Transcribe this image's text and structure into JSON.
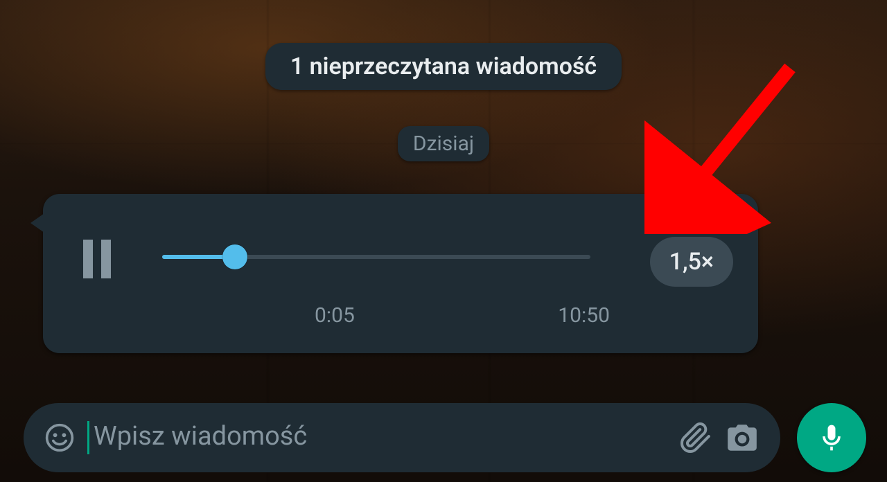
{
  "unread_banner": "1 nieprzeczytana wiadomość",
  "date_label": "Dzisiaj",
  "voice": {
    "current_time": "0:05",
    "timestamp": "10:50",
    "speed_label": "1,5×",
    "progress_pct": 17
  },
  "input": {
    "placeholder": "Wpisz wiadomość"
  },
  "colors": {
    "accent": "#00a884",
    "wave": "#53bdeb",
    "bubble": "#1f2c34",
    "annotation_arrow": "#ff0000"
  }
}
